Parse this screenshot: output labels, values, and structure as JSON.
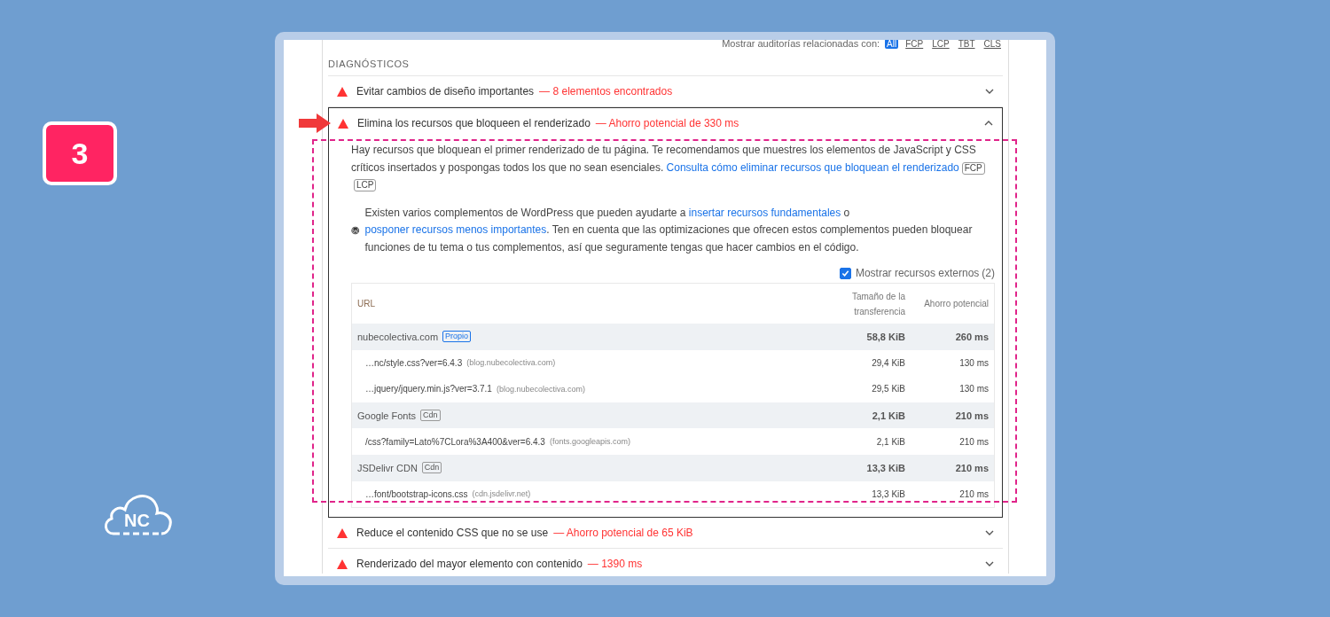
{
  "badge": {
    "number": "3"
  },
  "logo": {
    "text": "NC"
  },
  "filter": {
    "label": "Mostrar auditorías relacionadas con:",
    "options": [
      {
        "label": "All",
        "selected": true
      },
      {
        "label": "FCP",
        "selected": false
      },
      {
        "label": "LCP",
        "selected": false
      },
      {
        "label": "TBT",
        "selected": false
      },
      {
        "label": "CLS",
        "selected": false
      }
    ]
  },
  "section_title": "DIAGNÓSTICOS",
  "audits": [
    {
      "title": "Evitar cambios de diseño importantes",
      "detail": "— 8 elementos encontrados",
      "expanded": false,
      "highlighted": false
    },
    {
      "title": "Elimina los recursos que bloqueen el renderizado",
      "detail": "— Ahorro potencial de 330 ms",
      "expanded": true,
      "highlighted": true,
      "description": {
        "text": "Hay recursos que bloquean el primer renderizado de tu página. Te recomendamos que muestres los elementos de JavaScript y CSS críticos insertados y pospongas todos los que no sean esenciales. ",
        "link": "Consulta cómo eliminar recursos que bloquean el renderizado",
        "tags": [
          "FCP",
          "LCP"
        ]
      },
      "note": [
        {
          "kind": "text",
          "text": "Existen varios complementos de WordPress que pueden ayudarte a "
        },
        {
          "kind": "link",
          "text": "insertar recursos fundamentales"
        },
        {
          "kind": "text",
          "text": " o "
        },
        {
          "kind": "link",
          "text": "posponer recursos menos importantes"
        },
        {
          "kind": "text",
          "text": ". Ten en cuenta que las optimizaciones que ofrecen estos complementos pueden bloquear funciones de tu tema o tus complementos, así que seguramente tengas que hacer cambios en el código."
        }
      ],
      "checkbox": {
        "label": "Mostrar recursos externos",
        "count": "(2)",
        "checked": true
      },
      "table": {
        "columns": [
          "URL",
          "Tamaño de la transferencia",
          "Ahorro potencial"
        ],
        "groups": [
          {
            "name": "nubecolectiva.com",
            "tag": "Propio",
            "kind": "own",
            "size": "58,8 KiB",
            "savings": "260 ms",
            "items": [
              {
                "url": "…nc/style.css?ver=6.4.3",
                "host": "(blog.nubecolectiva.com)",
                "size": "29,4 KiB",
                "savings": "130 ms"
              },
              {
                "url": "…jquery/jquery.min.js?ver=3.7.1",
                "host": "(blog.nubecolectiva.com)",
                "size": "29,5 KiB",
                "savings": "130 ms"
              }
            ]
          },
          {
            "name": "Google Fonts",
            "tag": "Cdn",
            "kind": "cdn",
            "size": "2,1 KiB",
            "savings": "210 ms",
            "items": [
              {
                "url": "/css?family=Lato%7CLora%3A400&ver=6.4.3",
                "host": "(fonts.googleapis.com)",
                "size": "2,1 KiB",
                "savings": "210 ms"
              }
            ]
          },
          {
            "name": "JSDelivr CDN",
            "tag": "Cdn",
            "kind": "cdn",
            "size": "13,3 KiB",
            "savings": "210 ms",
            "items": [
              {
                "url": "…font/bootstrap-icons.css",
                "host": "(cdn.jsdelivr.net)",
                "size": "13,3 KiB",
                "savings": "210 ms"
              }
            ]
          }
        ]
      }
    },
    {
      "title": "Reduce el contenido CSS que no se use",
      "detail": "— Ahorro potencial de 65 KiB",
      "expanded": false,
      "highlighted": false
    },
    {
      "title": "Renderizado del mayor elemento con contenido",
      "detail": "— 1390 ms",
      "expanded": false,
      "highlighted": false
    }
  ]
}
